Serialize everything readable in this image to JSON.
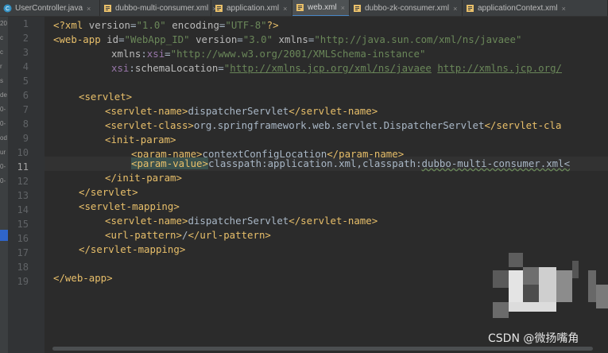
{
  "tabs": [
    {
      "label": "UserController.java",
      "icon": "java-class-icon",
      "active": false
    },
    {
      "label": "dubbo-multi-consumer.xml",
      "icon": "xml-file-icon",
      "active": false
    },
    {
      "label": "application.xml",
      "icon": "xml-file-icon",
      "active": false
    },
    {
      "label": "web.xml",
      "icon": "xml-file-icon",
      "active": true
    },
    {
      "label": "dubbo-zk-consumer.xml",
      "icon": "xml-file-icon",
      "active": false
    },
    {
      "label": "applicationContext.xml",
      "icon": "xml-file-icon",
      "active": false
    }
  ],
  "tab_close_glyph": "×",
  "strip_fragments": [
    "20",
    "c",
    "c",
    "r",
    "s",
    "de",
    "0-",
    "0-",
    "od",
    "ur",
    "0-",
    "0-",
    "",
    "",
    "",
    "",
    "",
    ""
  ],
  "line_numbers": [
    "1",
    "2",
    "3",
    "4",
    "5",
    "6",
    "7",
    "8",
    "9",
    "10",
    "11",
    "12",
    "13",
    "14",
    "15",
    "16",
    "17",
    "18",
    "19"
  ],
  "current_line": "11",
  "code": {
    "l1": {
      "p1": "<?",
      "p2": "xml",
      "p3": " version",
      "p4": "=",
      "p5": "\"1.0\"",
      "p6": " encoding",
      "p7": "=",
      "p8": "\"UTF-8\"",
      "p9": "?>"
    },
    "l2": {
      "open": "<web-app",
      "id_attr": " id",
      "eq1": "=",
      "id_val": "\"WebApp_ID\"",
      "ver_attr": " version",
      "eq2": "=",
      "ver_val": "\"3.0\"",
      "ns_attr": " xmlns",
      "eq3": "=",
      "ns_val": "\"http://java.sun.com/xml/ns/javaee\""
    },
    "l3": {
      "pre": "xmlns",
      "colon": ":",
      "name": "xsi",
      "eq": "=",
      "val": "\"http://www.w3.org/2001/XMLSchema-instance\""
    },
    "l4": {
      "pre": "xsi",
      "colon": ":",
      "name": "schemaLocation",
      "eq": "=",
      "q1": "\"",
      "u1": "http://xmlns.jcp.org/xml/ns/javaee",
      "sp": " ",
      "u2": "http://xmlns.jcp.org/"
    },
    "l6": "<servlet>",
    "l7": {
      "open": "<servlet-name>",
      "text": "dispatcherServlet",
      "close": "</servlet-name>"
    },
    "l8": {
      "open": "<servlet-class>",
      "text": "org.springframework.web.servlet.DispatcherServlet",
      "close": "</servlet-cla"
    },
    "l9": "<init-param>",
    "l10": {
      "open": "<param-name>",
      "text": "contextConfigLocation",
      "close": "</param-name>"
    },
    "l11": {
      "open": "<param-value>",
      "text1": "classpath:application.xml,classpath:",
      "text2": "dubbo-multi-consumer.xml<"
    },
    "l12": "</init-param>",
    "l13": "</servlet>",
    "l14": "<servlet-mapping>",
    "l15": {
      "open": "<servlet-name>",
      "text": "dispatcherServlet",
      "close": "</servlet-name>"
    },
    "l16": {
      "open": "<url-pattern>",
      "text": "/",
      "close": "</url-pattern>"
    },
    "l17": "</servlet-mapping>",
    "l19": "</web-app>"
  },
  "watermark": "CSDN @微扬嘴角",
  "colors": {
    "background": "#2b2b2b",
    "tag": "#e8bf6a",
    "attribute": "#bababa",
    "string": "#6a8759",
    "namespace": "#9876aa",
    "text": "#a9b7c6",
    "accent": "#4a88c7"
  }
}
